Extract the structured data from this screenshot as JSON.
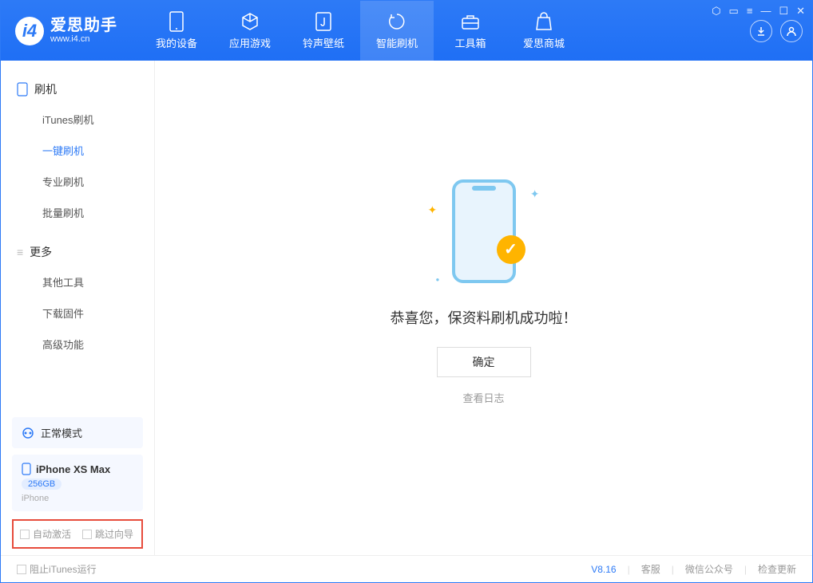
{
  "app": {
    "title": "爱思助手",
    "url": "www.i4.cn"
  },
  "nav": {
    "items": [
      {
        "label": "我的设备"
      },
      {
        "label": "应用游戏"
      },
      {
        "label": "铃声壁纸"
      },
      {
        "label": "智能刷机"
      },
      {
        "label": "工具箱"
      },
      {
        "label": "爱思商城"
      }
    ]
  },
  "sidebar": {
    "section1_title": "刷机",
    "section1_items": [
      "iTunes刷机",
      "一键刷机",
      "专业刷机",
      "批量刷机"
    ],
    "section2_title": "更多",
    "section2_items": [
      "其他工具",
      "下载固件",
      "高级功能"
    ],
    "status": "正常模式",
    "device": {
      "name": "iPhone XS Max",
      "capacity": "256GB",
      "type": "iPhone"
    },
    "checkbox1": "自动激活",
    "checkbox2": "跳过向导"
  },
  "main": {
    "success_msg": "恭喜您，保资料刷机成功啦！",
    "ok_btn": "确定",
    "log_link": "查看日志"
  },
  "footer": {
    "block_itunes": "阻止iTunes运行",
    "version": "V8.16",
    "links": [
      "客服",
      "微信公众号",
      "检查更新"
    ]
  }
}
